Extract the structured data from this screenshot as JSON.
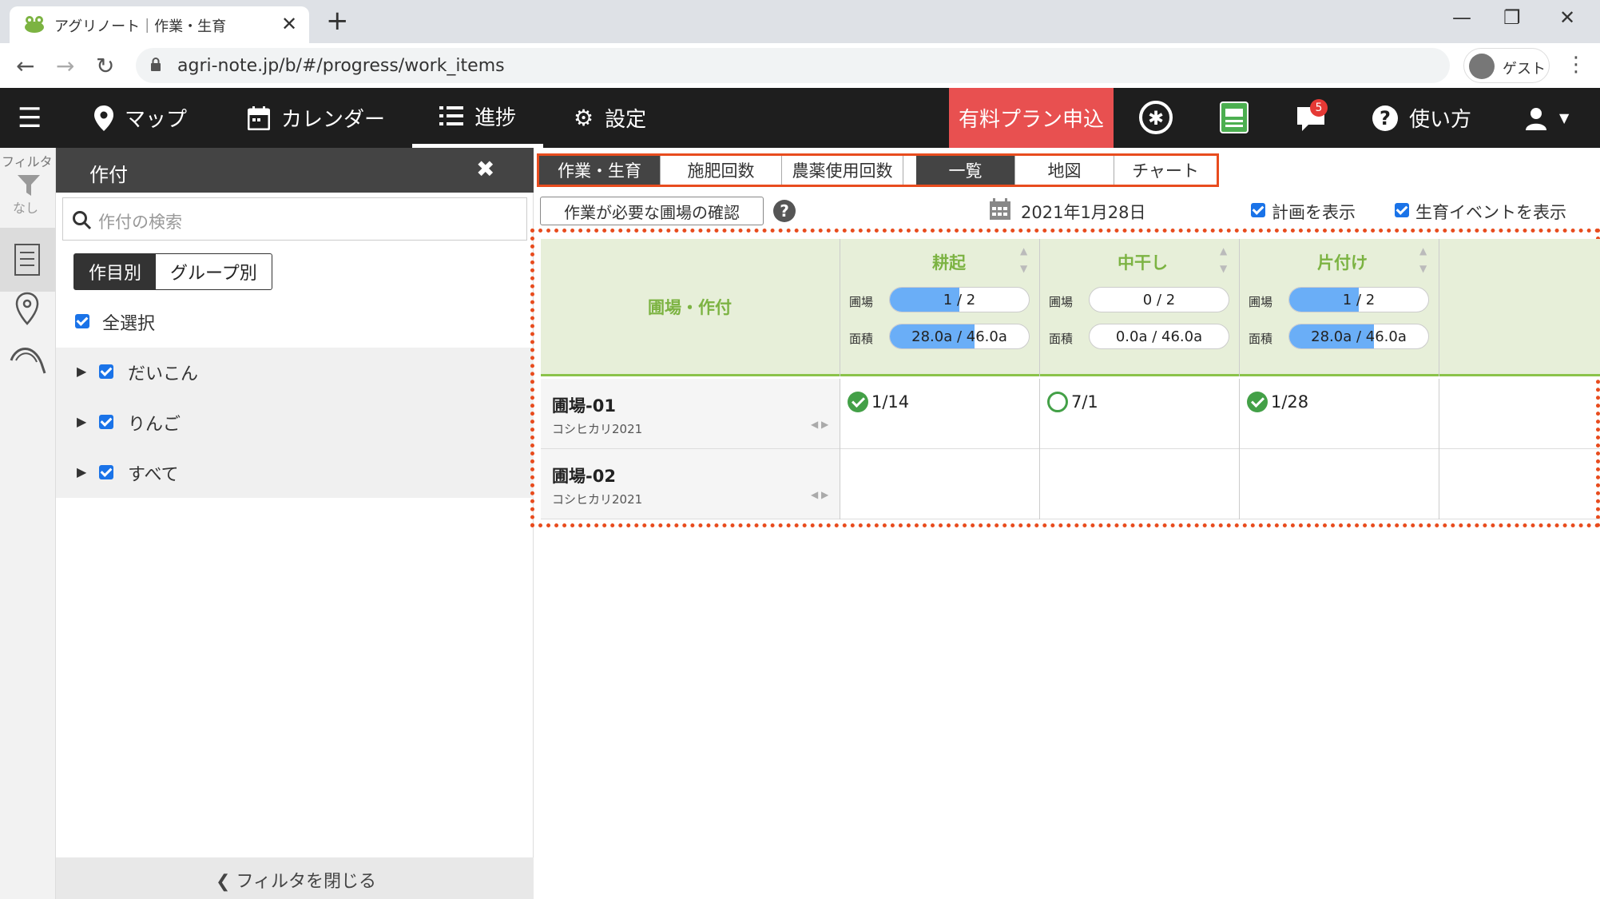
{
  "browser": {
    "tab_title": "アグリノート｜作業・生育",
    "url": "agri-note.jp/b/#/progress/work_items",
    "profile_label": "ゲスト"
  },
  "appnav": {
    "items": [
      {
        "label": "マップ",
        "icon": "map-pin-icon"
      },
      {
        "label": "カレンダー",
        "icon": "calendar-icon"
      },
      {
        "label": "進捗",
        "icon": "list-check-icon"
      },
      {
        "label": "設定",
        "icon": "gear-icon"
      }
    ],
    "paid_plan": "有料プラン申込",
    "notification_count": "5",
    "help_label": "使い方"
  },
  "leftstrip": {
    "filter_label": "フィルタ",
    "filter_state": "なし"
  },
  "filter_panel": {
    "title": "作付",
    "search_placeholder": "作付の検索",
    "toggle": [
      "作目別",
      "グループ別"
    ],
    "select_all": "全選択",
    "crops": [
      "だいこん",
      "りんご",
      "すべて"
    ],
    "close_label": "フィルタを閉じる"
  },
  "view_tabs": {
    "category": [
      "作業・生育",
      "施肥回数",
      "農薬使用回数"
    ],
    "display": [
      "一覧",
      "地図",
      "チャート"
    ]
  },
  "toolbar": {
    "check_button": "作業が必要な圃場の確認",
    "date": "2021年1月28日",
    "show_plan": "計画を表示",
    "show_events": "生育イベントを表示"
  },
  "grid": {
    "row_header": "圃場・作付",
    "field_label": "圃場",
    "area_label": "面積",
    "columns": [
      {
        "title": "耕起",
        "field_progress": "1 / 2",
        "field_ratio": 0.5,
        "area_progress": "28.0a / 46.0a",
        "area_ratio": 0.609
      },
      {
        "title": "中干し",
        "field_progress": "0 / 2",
        "field_ratio": 0,
        "area_progress": "0.0a / 46.0a",
        "area_ratio": 0
      },
      {
        "title": "片付け",
        "field_progress": "1 / 2",
        "field_ratio": 0.5,
        "area_progress": "28.0a / 46.0a",
        "area_ratio": 0.609
      }
    ],
    "rows": [
      {
        "field": "圃場-01",
        "crop": "コシヒカリ2021",
        "cells": [
          {
            "status": "done",
            "date": "1/14"
          },
          {
            "status": "planned",
            "date": "7/1"
          },
          {
            "status": "done",
            "date": "1/28"
          }
        ]
      },
      {
        "field": "圃場-02",
        "crop": "コシヒカリ2021",
        "cells": [
          {
            "status": "",
            "date": ""
          },
          {
            "status": "",
            "date": ""
          },
          {
            "status": "",
            "date": ""
          }
        ]
      }
    ]
  }
}
